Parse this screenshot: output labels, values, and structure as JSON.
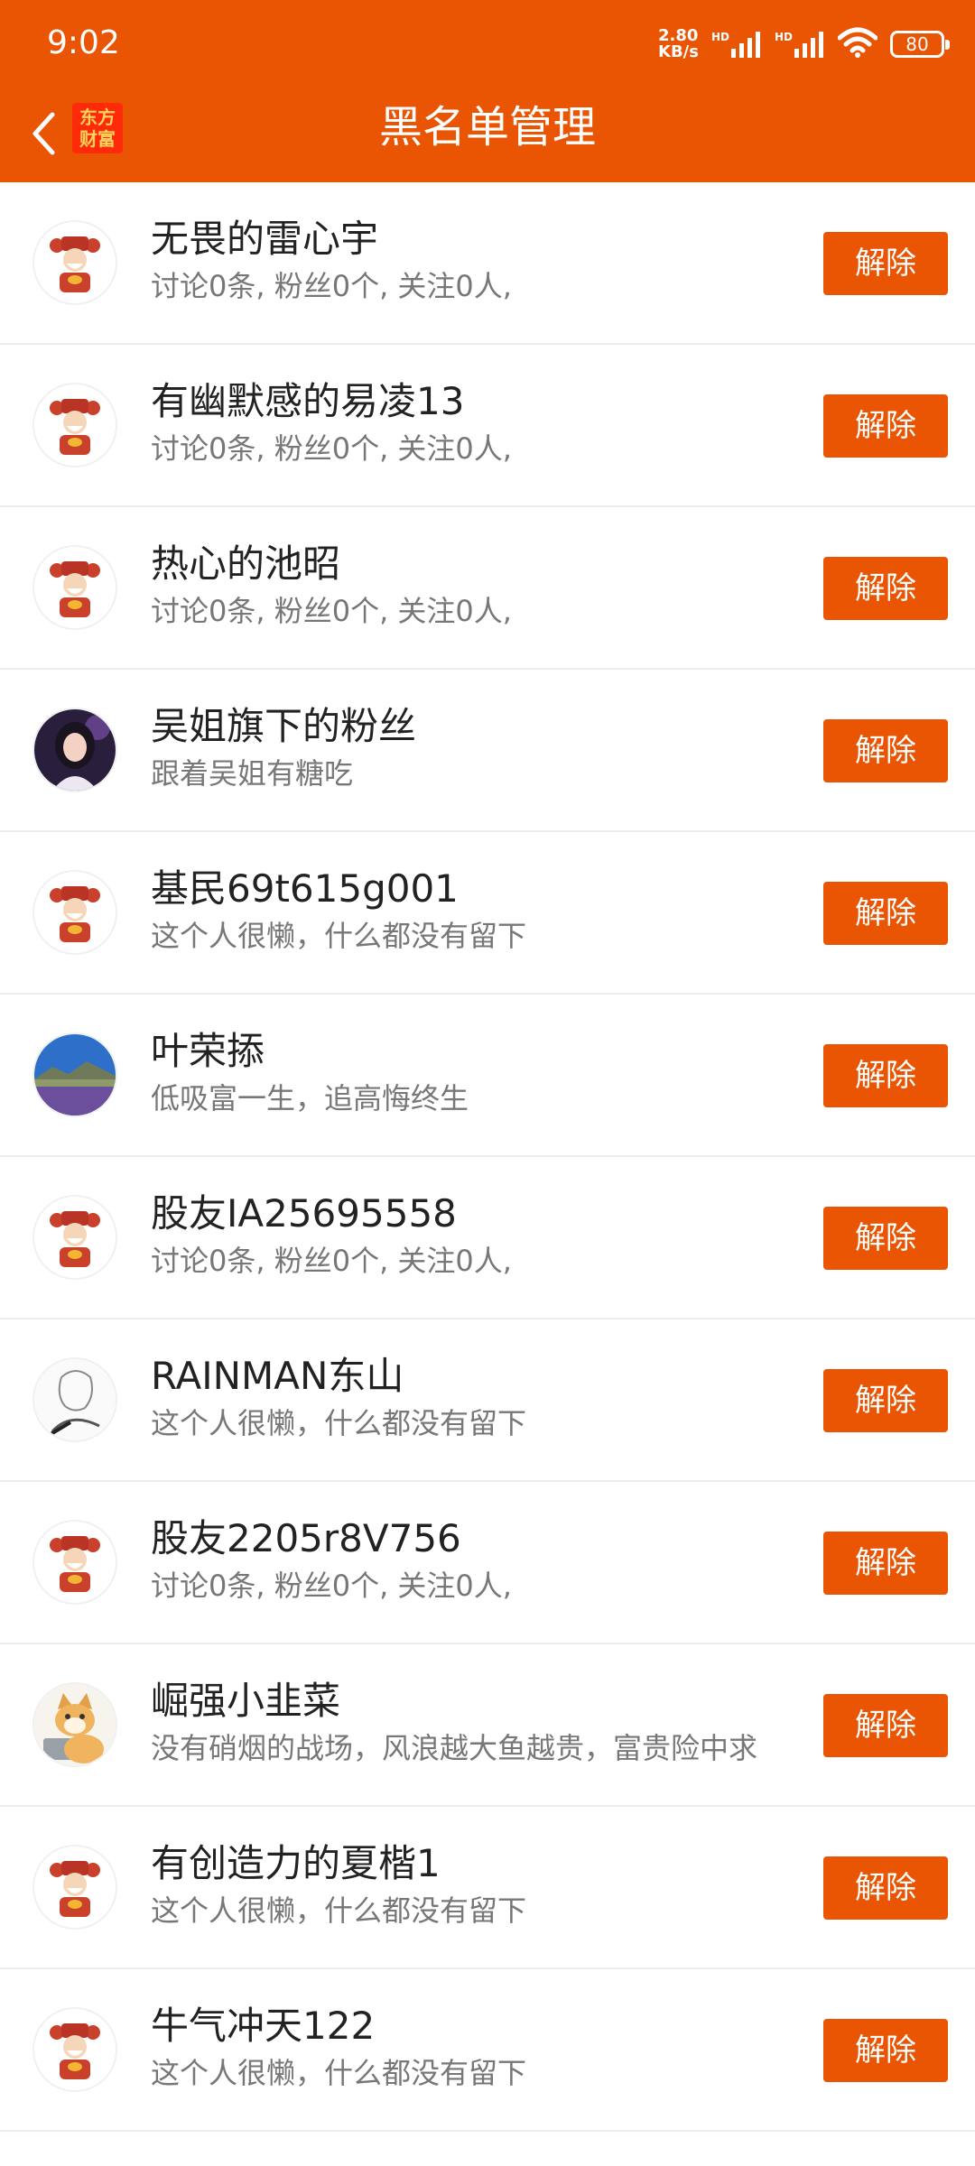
{
  "status_bar": {
    "time": "9:02",
    "net_speed_value": "2.80",
    "net_speed_unit": "KB/s",
    "hd1": "HD",
    "hd2": "HD",
    "battery": "80"
  },
  "header": {
    "title": "黑名单管理",
    "logo_line1": "东方",
    "logo_line2": "财富",
    "back_icon": "chevron-left-icon"
  },
  "colors": {
    "accent": "#EA5504",
    "divider": "#EDEDED"
  },
  "blacklist": [
    {
      "name": "无畏的雷心宇",
      "desc": "讨论0条, 粉丝0个, 关注0人,",
      "avatar": "caishen-avatar",
      "action": "解除"
    },
    {
      "name": "有幽默感的易凌13",
      "desc": "讨论0条, 粉丝0个, 关注0人,",
      "avatar": "caishen-avatar",
      "action": "解除"
    },
    {
      "name": "热心的池昭",
      "desc": "讨论0条, 粉丝0个, 关注0人,",
      "avatar": "caishen-avatar",
      "action": "解除"
    },
    {
      "name": "吴姐旗下的粉丝",
      "desc": "跟着吴姐有糖吃",
      "avatar": "photo-avatar-girl",
      "action": "解除"
    },
    {
      "name": "基民69t615g001",
      "desc": "这个人很懒，什么都没有留下",
      "avatar": "caishen-avatar",
      "action": "解除"
    },
    {
      "name": "叶荣掭",
      "desc": "低吸富一生，追高悔终生",
      "avatar": "landscape-avatar",
      "action": "解除"
    },
    {
      "name": "股友IA25695558",
      "desc": "讨论0条, 粉丝0个, 关注0人,",
      "avatar": "caishen-avatar",
      "action": "解除"
    },
    {
      "name": "RAINMAN东山",
      "desc": "这个人很懒，什么都没有留下",
      "avatar": "sketch-avatar",
      "action": "解除"
    },
    {
      "name": "股友2205r8V756",
      "desc": "讨论0条, 粉丝0个, 关注0人,",
      "avatar": "caishen-avatar",
      "action": "解除"
    },
    {
      "name": "崛强小韭菜",
      "desc": "没有硝烟的战场，风浪越大鱼越贵，富贵险中求",
      "avatar": "cat-avatar",
      "action": "解除"
    },
    {
      "name": "有创造力的夏楷1",
      "desc": "这个人很懒，什么都没有留下",
      "avatar": "caishen-avatar",
      "action": "解除"
    },
    {
      "name": "牛气冲天122",
      "desc": "这个人很懒，什么都没有留下",
      "avatar": "caishen-avatar",
      "action": "解除"
    }
  ]
}
